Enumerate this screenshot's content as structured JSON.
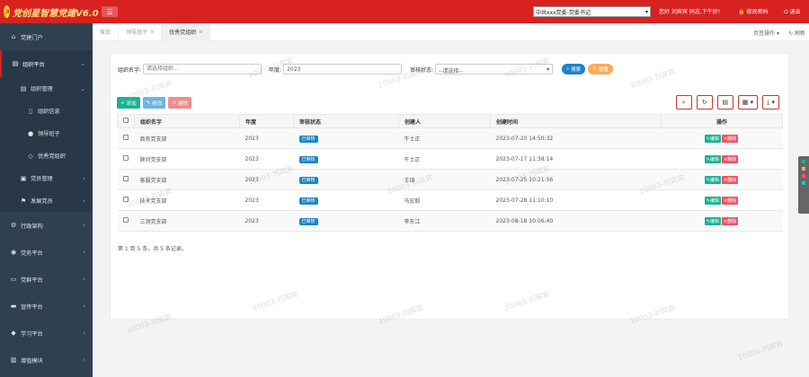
{
  "header": {
    "brand": "党创星智慧党建V6.0",
    "org_select": "中共xxx党委-党委书记",
    "greeting": "您好 刘宾宾 同志,下午好!",
    "change_password": "修改密码",
    "logout": "退出"
  },
  "sidebar": {
    "items": [
      {
        "label": "党建门户"
      },
      {
        "label": "组织平台"
      },
      {
        "label": "组织管理"
      },
      {
        "label": "组织信息"
      },
      {
        "label": "领导班子"
      },
      {
        "label": "优秀党组织"
      },
      {
        "label": "党员管理"
      },
      {
        "label": "发展党员"
      },
      {
        "label": "行政架构"
      },
      {
        "label": "党务平台"
      },
      {
        "label": "党群平台"
      },
      {
        "label": "宣传平台"
      },
      {
        "label": "学习平台"
      },
      {
        "label": "增值模块"
      }
    ]
  },
  "tabs": {
    "items": [
      {
        "label": "首页"
      },
      {
        "label": "领导班子"
      },
      {
        "label": "优秀党组织"
      }
    ],
    "page_ops": "页签操作",
    "refresh": "刷新"
  },
  "search": {
    "org_name_label": "组织名字:",
    "org_name_placeholder": "请选择组织...",
    "year_label": "年度:",
    "year_value": "2023",
    "status_label": "审核状态:",
    "status_value": "--请选择--",
    "search_btn": "搜索",
    "reset_btn": "重置"
  },
  "toolbar": {
    "add": "添加",
    "edit": "修改",
    "delete": "删除"
  },
  "table": {
    "headers": [
      "组织名字",
      "年度",
      "审核状态",
      "创建人",
      "创建时间",
      "操作"
    ],
    "edit_label": "编辑",
    "delete_label": "删除",
    "rows": [
      {
        "name": "商务党支部",
        "year": "2023",
        "status": "已审核",
        "creator": "牛士正",
        "created": "2023-07-20 14:50:32"
      },
      {
        "name": "顾问党支部",
        "year": "2023",
        "status": "已审核",
        "creator": "牛士正",
        "created": "2023-07-17 11:38:14"
      },
      {
        "name": "客服党支部",
        "year": "2023",
        "status": "已审核",
        "creator": "王琦",
        "created": "2023-07-25 10:21:56"
      },
      {
        "name": "技术党支部",
        "year": "2023",
        "status": "已审核",
        "creator": "马宏毅",
        "created": "2023-07-28 11:10:10"
      },
      {
        "name": "三测党支部",
        "year": "2023",
        "status": "已审核",
        "creator": "李东江",
        "created": "2023-08-18 10:06:40"
      }
    ]
  },
  "pager": "第 1 到 5 条，共 5 条记录。",
  "watermark": "10003-刘宾宾"
}
